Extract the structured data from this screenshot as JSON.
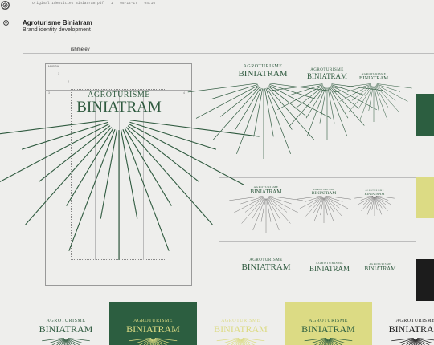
{
  "topbar": {
    "crumbs": [
      "Original Identities Biniatram.pdf",
      "1",
      "05-14-17",
      "04:16"
    ]
  },
  "header": {
    "title": "Agroturisme Biniatram",
    "subtitle": "Brand identity development"
  },
  "author": "ishmelev",
  "brand": {
    "line1": "AGROTURISME",
    "line2": "BINIATRAM"
  },
  "guide": {
    "margin_label": "MARGIN",
    "numbers": [
      "1",
      "2",
      "3",
      "4"
    ]
  },
  "colors": {
    "green": "#2c5e40",
    "yellow": "#dcdb84",
    "black": "#1c1c1c",
    "light_text": "#e6e3b2",
    "bg": "#eeeeec"
  },
  "bottom_row": [
    {
      "bg": "#eeeeec",
      "fg": "#2f5a3f"
    },
    {
      "bg": "#2c5e40",
      "fg": "#dcdb84"
    },
    {
      "bg": "#eeeeec",
      "fg": "#dcdb84"
    },
    {
      "bg": "#dcdb84",
      "fg": "#2c5e40"
    },
    {
      "bg": "#eeeeec",
      "fg": "#1c1c1c"
    }
  ]
}
